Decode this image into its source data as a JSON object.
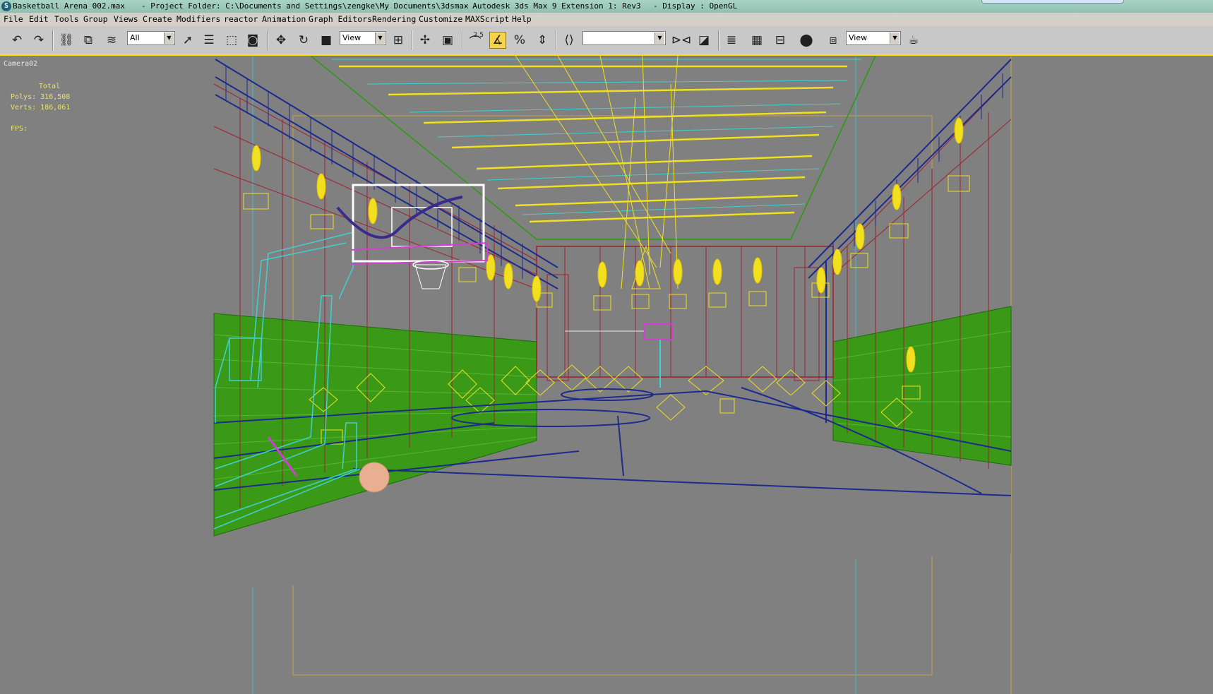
{
  "titlebar": {
    "file": "Basketball Arena 002.max",
    "project": "- Project Folder: C:\\Documents and Settings\\zengke\\My Documents\\3dsmax",
    "app": "- Autodesk 3ds Max 9 Extension 1: Rev3",
    "display": "- Display : OpenGL"
  },
  "menu": [
    "File",
    "Edit",
    "Tools",
    "Group",
    "Views",
    "Create",
    "Modifiers",
    "reactor",
    "Animation",
    "Graph Editors",
    "Rendering",
    "Customize",
    "MAXScript",
    "Help"
  ],
  "toolbar": {
    "selection_filter": "All",
    "ref_coord": "View",
    "named_selection": "",
    "render_view": "View",
    "snap_label": "2.5"
  },
  "viewport": {
    "label": "Camera02",
    "stats_title": "Total",
    "polys_label": "Polys:",
    "polys_value": "316,508",
    "verts_label": "Verts:",
    "verts_value": "186,061",
    "fps_label": "FPS:"
  },
  "colors": {
    "frame_active": "#ffe000",
    "wire_yellow": "#f0e020",
    "wire_blue": "#1c2a8c",
    "wire_red": "#a02030",
    "wire_green": "#2a9a10",
    "wire_cyan": "#40d0d0",
    "wire_white": "#ffffff",
    "wire_magenta": "#d040d0"
  }
}
